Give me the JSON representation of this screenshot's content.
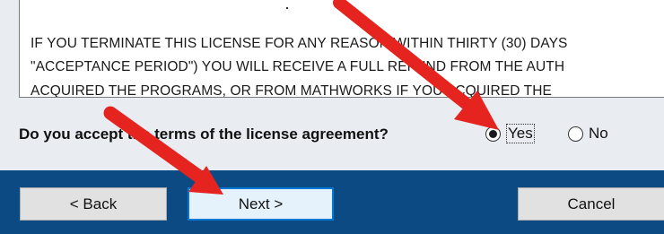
{
  "license": {
    "lines": [
      "IF YOU TERMINATE THIS LICENSE FOR ANY REASON WITHIN THIRTY (30) DAYS",
      "\"ACCEPTANCE PERIOD\") YOU WILL RECEIVE A FULL REFUND FROM THE AUTH",
      "ACQUIRED THE PROGRAMS, OR FROM MATHWORKS IF YOU ACQUIRED THE"
    ]
  },
  "acceptance": {
    "question": "Do you accept the terms of the license agreement?",
    "options": [
      {
        "label": "Yes",
        "selected": true
      },
      {
        "label": "No",
        "selected": false
      }
    ]
  },
  "buttons": {
    "back": "< Back",
    "next": "Next >",
    "cancel": "Cancel"
  },
  "colors": {
    "annotation_arrow": "#e52420",
    "footer": "#0b4a82",
    "dialog_background": "#e9edf1",
    "primary_border": "#0078d7"
  }
}
